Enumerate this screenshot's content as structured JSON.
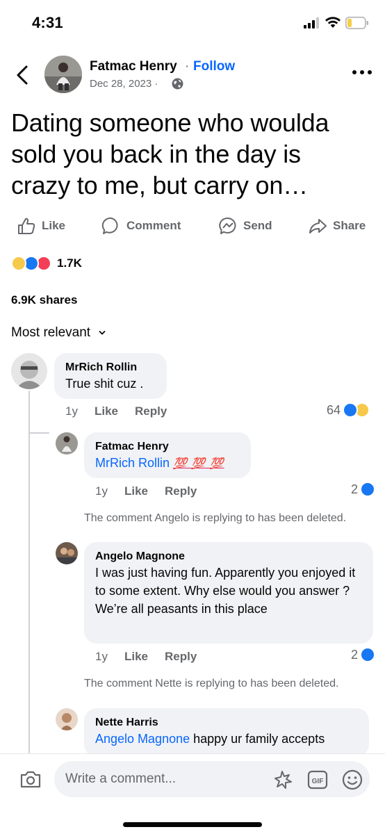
{
  "status_bar": {
    "time": "4:31"
  },
  "header": {
    "author": "Fatmac Henry",
    "separator": "·",
    "follow_label": "Follow",
    "date": "Dec 28, 2023 ·",
    "icons": [
      "back-icon",
      "globe-icon",
      "more-icon"
    ]
  },
  "post": {
    "text": "Dating someone who woulda sold you back in the day is crazy to me, but carry on…"
  },
  "actions": {
    "like": "Like",
    "comment": "Comment",
    "send": "Send",
    "share": "Share"
  },
  "reactions": {
    "count": "1.7K",
    "types": [
      "haha",
      "like",
      "love"
    ]
  },
  "shares": "6.9K shares",
  "sort_label": "Most relevant",
  "comments": [
    {
      "name": "MrRich Rollin",
      "text": "True shit cuz .",
      "age": "1y",
      "like_label": "Like",
      "reply_label": "Reply",
      "reaction_count": "64",
      "reaction_types": [
        "like",
        "haha"
      ]
    },
    {
      "name": "Fatmac Henry",
      "mention": "MrRich Rollin",
      "emoji_text": "💯 💯 💯",
      "age": "1y",
      "like_label": "Like",
      "reply_label": "Reply",
      "reaction_count": "2",
      "reaction_types": [
        "like"
      ]
    },
    {
      "deleted_notice": "The comment Angelo is replying to has been deleted.",
      "name": "Angelo Magnone",
      "text": "I was just having fun. Apparently you enjoyed it to some extent. Why else would you answer ?  We’re all peasants in this place",
      "age": "1y",
      "like_label": "Like",
      "reply_label": "Reply",
      "reaction_count": "2",
      "reaction_types": [
        "like"
      ]
    },
    {
      "deleted_notice": "The comment Nette is replying to has been deleted.",
      "name": "Nette Harris",
      "mention": "Angelo Magnone",
      "text": " happy ur family accepts"
    }
  ],
  "composer": {
    "placeholder": "Write a comment...",
    "icons": [
      "camera-icon",
      "sticker-icon",
      "gif-icon",
      "emoji-icon"
    ]
  },
  "colors": {
    "accent": "#0866ff",
    "secondary_text": "#65676b",
    "bubble": "#f0f2f5"
  }
}
